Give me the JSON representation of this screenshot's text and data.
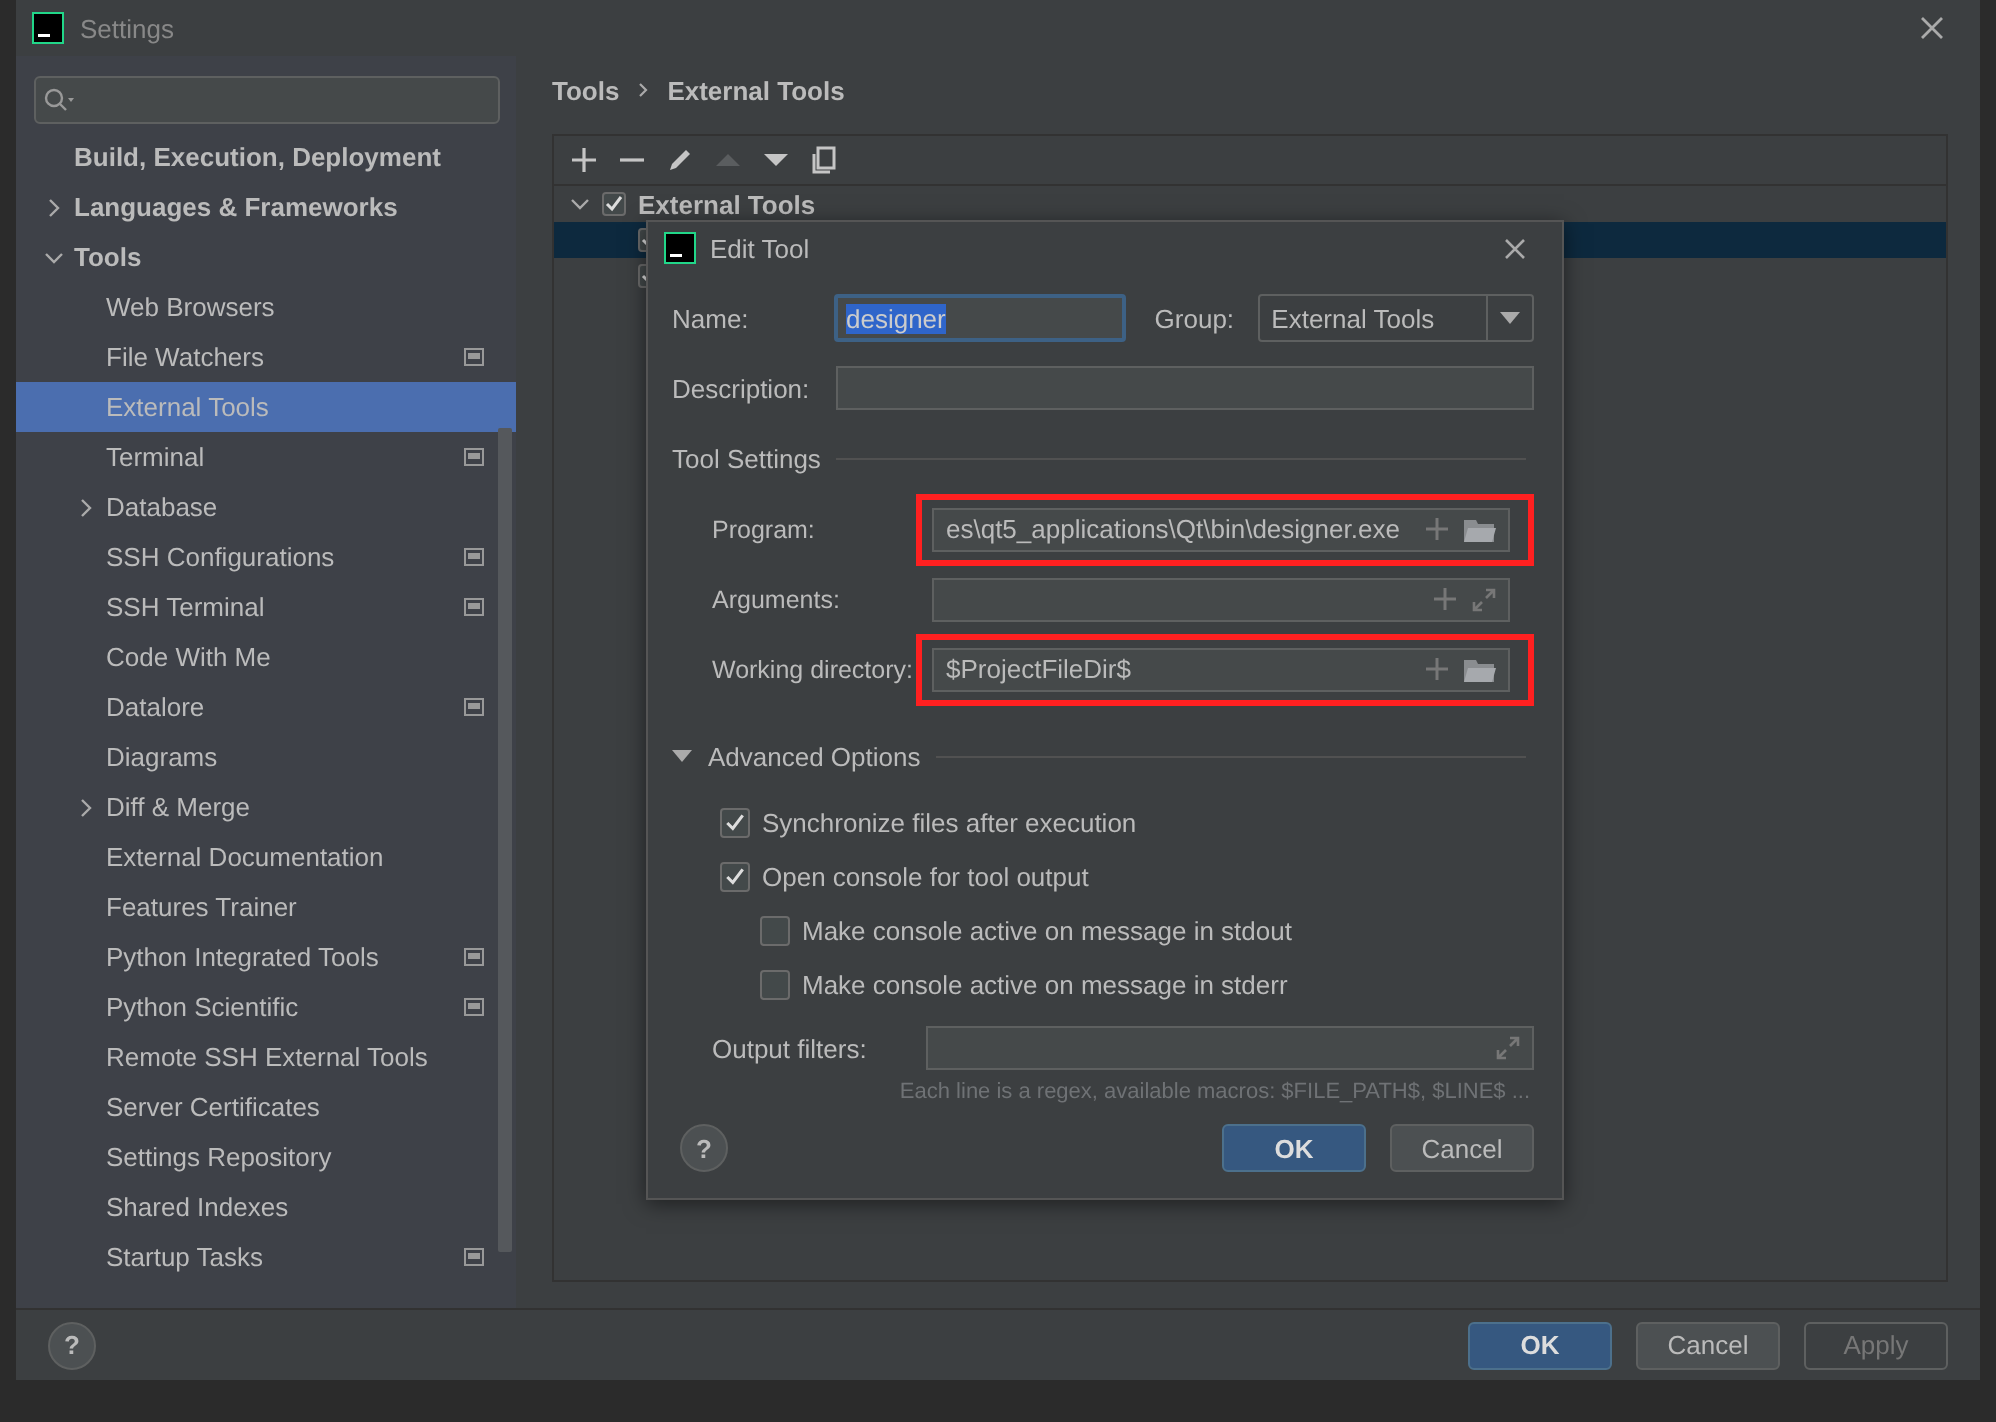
{
  "window": {
    "title": "Settings"
  },
  "sidebar": {
    "items": [
      {
        "label": "Build, Execution, Deployment",
        "selected": false
      },
      {
        "label": "Languages & Frameworks",
        "selected": false,
        "expanded": false
      },
      {
        "label": "Tools",
        "selected": false,
        "expanded": true,
        "children": [
          {
            "label": "Web Browsers",
            "selected": false,
            "project_icon": false
          },
          {
            "label": "File Watchers",
            "selected": false,
            "project_icon": true
          },
          {
            "label": "External Tools",
            "selected": true,
            "project_icon": false
          },
          {
            "label": "Terminal",
            "selected": false,
            "project_icon": true
          },
          {
            "label": "Database",
            "selected": false,
            "project_icon": false,
            "expanded": false
          },
          {
            "label": "SSH Configurations",
            "selected": false,
            "project_icon": true
          },
          {
            "label": "SSH Terminal",
            "selected": false,
            "project_icon": true
          },
          {
            "label": "Code With Me",
            "selected": false,
            "project_icon": false
          },
          {
            "label": "Datalore",
            "selected": false,
            "project_icon": true
          },
          {
            "label": "Diagrams",
            "selected": false,
            "project_icon": false
          },
          {
            "label": "Diff & Merge",
            "selected": false,
            "project_icon": false,
            "expanded": false
          },
          {
            "label": "External Documentation",
            "selected": false,
            "project_icon": false
          },
          {
            "label": "Features Trainer",
            "selected": false,
            "project_icon": false
          },
          {
            "label": "Python Integrated Tools",
            "selected": false,
            "project_icon": true
          },
          {
            "label": "Python Scientific",
            "selected": false,
            "project_icon": true
          },
          {
            "label": "Remote SSH External Tools",
            "selected": false,
            "project_icon": false
          },
          {
            "label": "Server Certificates",
            "selected": false,
            "project_icon": false
          },
          {
            "label": "Settings Repository",
            "selected": false,
            "project_icon": false
          },
          {
            "label": "Shared Indexes",
            "selected": false,
            "project_icon": false
          },
          {
            "label": "Startup Tasks",
            "selected": false,
            "project_icon": true
          }
        ]
      }
    ]
  },
  "breadcrumb": [
    "Tools",
    "External Tools"
  ],
  "toolbar": [
    {
      "kind": "add",
      "disabled": false
    },
    {
      "kind": "remove",
      "disabled": false
    },
    {
      "kind": "edit",
      "disabled": false
    },
    {
      "kind": "up",
      "disabled": true
    },
    {
      "kind": "down",
      "disabled": false
    },
    {
      "kind": "copy",
      "disabled": false
    }
  ],
  "tree": {
    "label": "External Tools",
    "checked": true,
    "expanded": true,
    "children": [
      {
        "checked": true,
        "selected": true
      },
      {
        "checked": true,
        "selected": false
      }
    ]
  },
  "dialog": {
    "title": "Edit Tool",
    "name": {
      "label": "Name:",
      "value": "designer"
    },
    "group": {
      "label": "Group:",
      "value": "External Tools"
    },
    "description": {
      "label": "Description:"
    },
    "tool_settings": {
      "title": "Tool Settings",
      "fields": [
        {
          "label": "Program:",
          "value": "es\\qt5_applications\\Qt\\bin\\designer.exe",
          "highlighted": true,
          "kind": "path"
        },
        {
          "label": "Arguments:",
          "highlighted": false,
          "kind": "text"
        },
        {
          "label": "Working directory:",
          "value": "$ProjectFileDir$",
          "highlighted": true,
          "kind": "path"
        }
      ]
    },
    "advanced": {
      "title": "Advanced Options",
      "expanded": true,
      "options": [
        {
          "label": "Synchronize files after execution",
          "checked": true,
          "indented": false
        },
        {
          "label": "Open console for tool output",
          "checked": true,
          "indented": false
        },
        {
          "label": "Make console active on message in stdout",
          "checked": false,
          "indented": true
        },
        {
          "label": "Make console active on message in stderr",
          "checked": false,
          "indented": true
        }
      ]
    },
    "output_filters": {
      "label": "Output filters:"
    },
    "hint": "Each line is a regex, available macros: $FILE_PATH$, $LINE$ ...",
    "help": "?",
    "buttons": [
      {
        "label": "OK",
        "primary": true,
        "disabled": false
      },
      {
        "label": "Cancel",
        "primary": false,
        "disabled": false
      }
    ]
  },
  "footer": {
    "help": "?",
    "buttons": [
      {
        "label": "OK",
        "primary": true,
        "disabled": false
      },
      {
        "label": "Cancel",
        "primary": false,
        "disabled": false
      },
      {
        "label": "Apply",
        "primary": false,
        "disabled": true
      }
    ]
  }
}
